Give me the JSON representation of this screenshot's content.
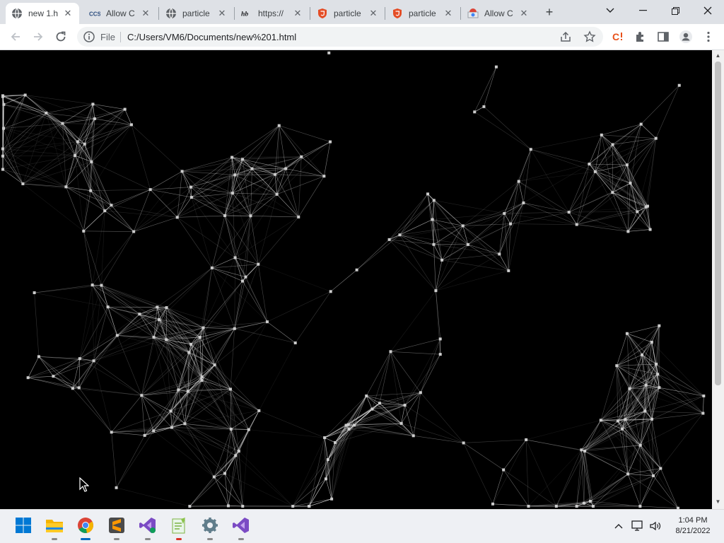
{
  "browser": {
    "tabs": [
      {
        "title": "new 1.h",
        "favicon": "globe-icon",
        "active": true
      },
      {
        "title": "Allow C",
        "favicon": "ccs-logo-icon",
        "active": false
      },
      {
        "title": "particle",
        "favicon": "globe-icon",
        "active": false
      },
      {
        "title": "https://",
        "favicon": "hb-logo-icon",
        "active": false
      },
      {
        "title": "particle",
        "favicon": "shield-logo-icon",
        "active": false
      },
      {
        "title": "particle",
        "favicon": "shield-logo-icon",
        "active": false
      },
      {
        "title": "Allow C",
        "favicon": "chrome-store-icon",
        "active": false
      }
    ],
    "new_tab_label": "+",
    "address": {
      "scheme_label": "File",
      "url": "C:/Users/VM6/Documents/new%201.html"
    }
  },
  "page": {
    "content": "particles-network-animation",
    "background": "#000000",
    "line_color": "#ffffff",
    "particle_color": "#cccccc"
  },
  "taskbar": {
    "apps": [
      "windows-start-icon",
      "file-explorer-icon",
      "chrome-icon",
      "sublime-text-icon",
      "visual-studio-icon",
      "notepad-plus-plus-icon",
      "settings-icon",
      "visual-studio-alt-icon"
    ],
    "active_app": "chrome-icon",
    "clock": {
      "time": "1:04 PM",
      "date": "8/21/2022"
    }
  }
}
